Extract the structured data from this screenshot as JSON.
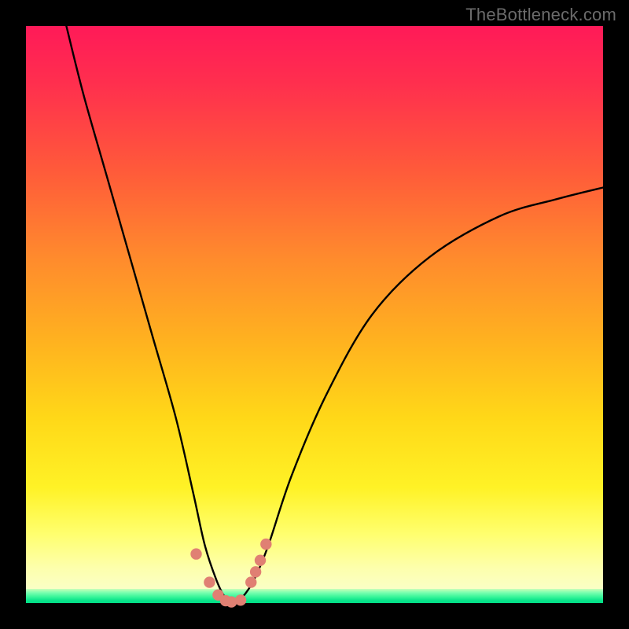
{
  "watermark": "TheBottleneck.com",
  "chart_data": {
    "type": "line",
    "title": "",
    "xlabel": "",
    "ylabel": "",
    "xlim": [
      0,
      100
    ],
    "ylim": [
      0,
      100
    ],
    "note": "Axes are unlabeled in the source image; values are proportional positions (0–100). The single black curve has a sharp minimum near x≈35 reaching y≈0, with the left branch starting at y≈100 (top) and the right branch ending near y≈72 at the right edge.",
    "series": [
      {
        "name": "bottleneck-curve",
        "x": [
          7,
          10,
          14,
          18,
          22,
          26,
          29,
          31,
          33,
          34.5,
          36,
          37.5,
          39.5,
          42,
          46,
          52,
          60,
          70,
          82,
          92,
          100
        ],
        "y": [
          100,
          88,
          74,
          60,
          46,
          32,
          19,
          10,
          4,
          1,
          0,
          1,
          4,
          10,
          22,
          36,
          50,
          60,
          67,
          70,
          72
        ]
      }
    ],
    "markers": {
      "name": "salmon-dots",
      "color": "#e08073",
      "x": [
        29.5,
        31.8,
        33.3,
        34.6,
        35.6,
        37.2,
        39.0,
        39.8,
        40.6,
        41.6
      ],
      "y": [
        8.5,
        3.6,
        1.4,
        0.4,
        0.2,
        0.5,
        3.6,
        5.4,
        7.4,
        10.2
      ]
    },
    "background": {
      "gradient": [
        "#ff1a58",
        "#ff8a2d",
        "#ffe626",
        "#fdffad"
      ],
      "bottom_band_color": "#0ce58b"
    }
  }
}
